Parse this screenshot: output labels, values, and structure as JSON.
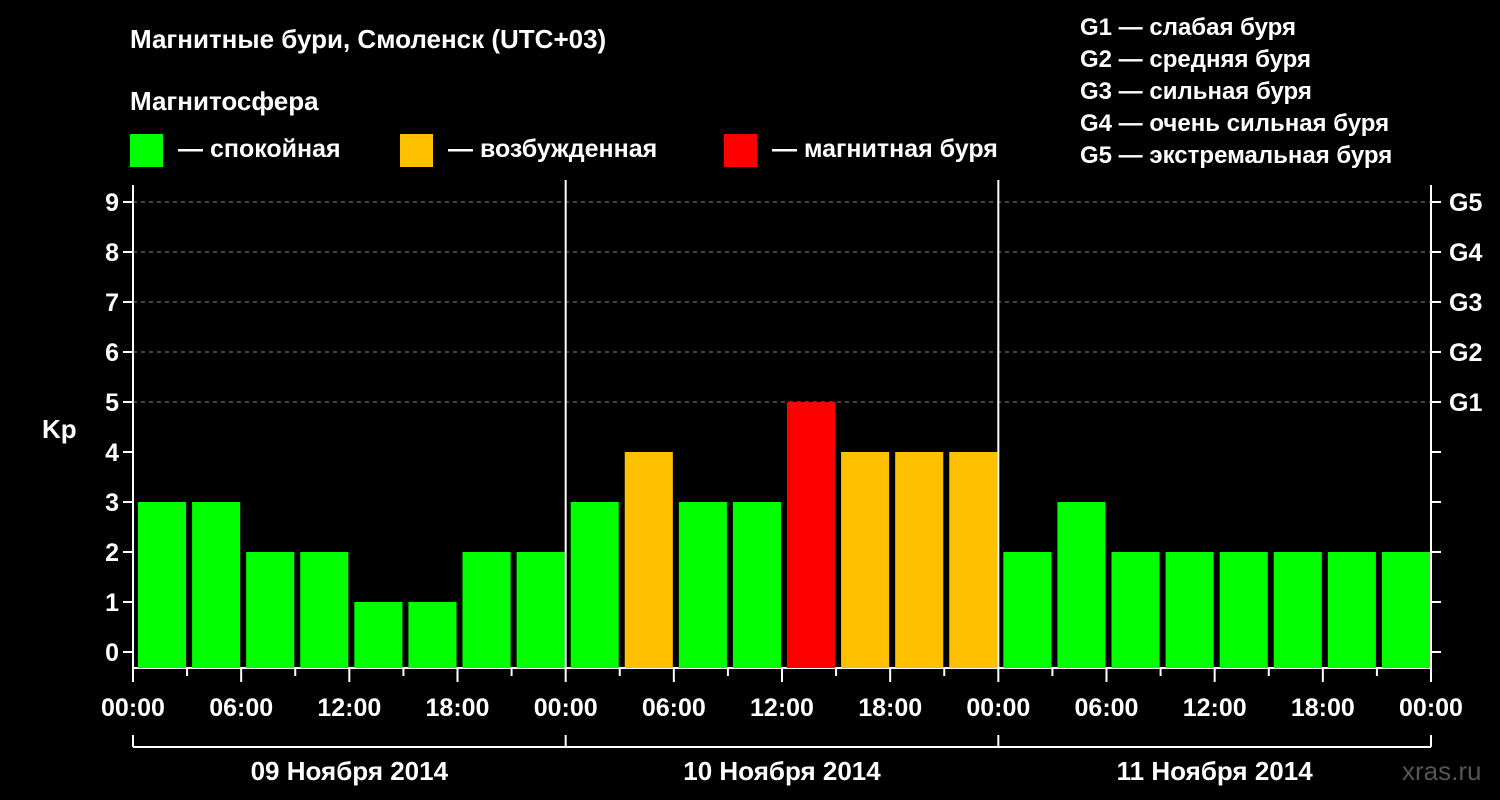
{
  "title": "Магнитные бури, Смоленск (UTC+03)",
  "legend": {
    "title": "Магнитосфера",
    "items": [
      {
        "label": "— спокойная",
        "color": "#00ff00"
      },
      {
        "label": "— возбужденная",
        "color": "#ffc000"
      },
      {
        "label": "— магнитная буря",
        "color": "#ff0000"
      }
    ]
  },
  "g_scale": [
    "G1 — слабая буря",
    "G2 — средняя буря",
    "G3 — сильная буря",
    "G4 — очень сильная буря",
    "G5 — экстремальная буря"
  ],
  "watermark": "xras.ru",
  "chart_data": {
    "type": "bar",
    "ylabel": "Kp",
    "ylim": [
      0,
      9
    ],
    "yticks": [
      0,
      1,
      2,
      3,
      4,
      5,
      6,
      7,
      8,
      9
    ],
    "right_ticks": [
      {
        "value": 5,
        "label": "G1"
      },
      {
        "value": 6,
        "label": "G2"
      },
      {
        "value": 7,
        "label": "G3"
      },
      {
        "value": 8,
        "label": "G4"
      },
      {
        "value": 9,
        "label": "G5"
      }
    ],
    "grid": "dashed horizontal lines at 5-9",
    "x_tick_labels": [
      "00:00",
      "06:00",
      "12:00",
      "18:00",
      "00:00",
      "06:00",
      "12:00",
      "18:00",
      "00:00",
      "06:00",
      "12:00",
      "18:00",
      "00:00"
    ],
    "days": [
      "09 Ноября 2014",
      "10 Ноября 2014",
      "11 Ноября 2014"
    ],
    "interval_hours": 3,
    "values": [
      3,
      3,
      2,
      2,
      1,
      1,
      2,
      2,
      3,
      4,
      3,
      3,
      5,
      4,
      4,
      4,
      2,
      3,
      2,
      2,
      2,
      2,
      2,
      2
    ],
    "colors": {
      "calm": "#00ff00",
      "disturbed": "#ffc000",
      "storm": "#ff0000"
    }
  }
}
